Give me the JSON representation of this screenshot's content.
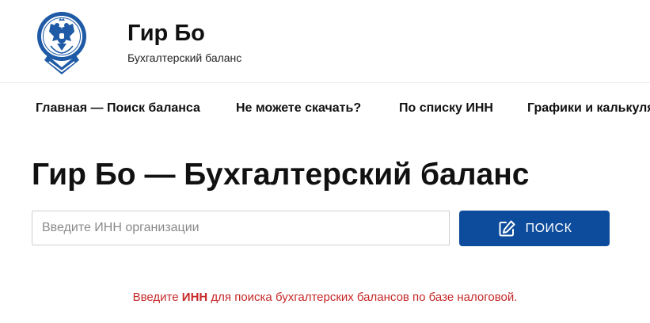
{
  "header": {
    "title": "Гир Бо",
    "subtitle": "Бухгалтерский баланс"
  },
  "nav": {
    "items": [
      {
        "label": "Главная — Поиск баланса"
      },
      {
        "label": "Не можете скачать?"
      },
      {
        "label": "По списку ИНН"
      },
      {
        "label": "Графики и калькуляторы"
      }
    ]
  },
  "main": {
    "title": "Гир Бо — Бухгалтерский баланс",
    "search": {
      "placeholder": "Введите ИНН организации",
      "value": "",
      "button_label": "ПОИСК",
      "button_icon": "edit-icon"
    },
    "hint": {
      "prefix": "Введите ",
      "strong": "ИНН",
      "suffix": " для поиска бухгалтерских балансов по базе налоговой."
    }
  },
  "colors": {
    "accent": "#0d4c9c",
    "hint": "#c62828",
    "text": "#111111"
  }
}
